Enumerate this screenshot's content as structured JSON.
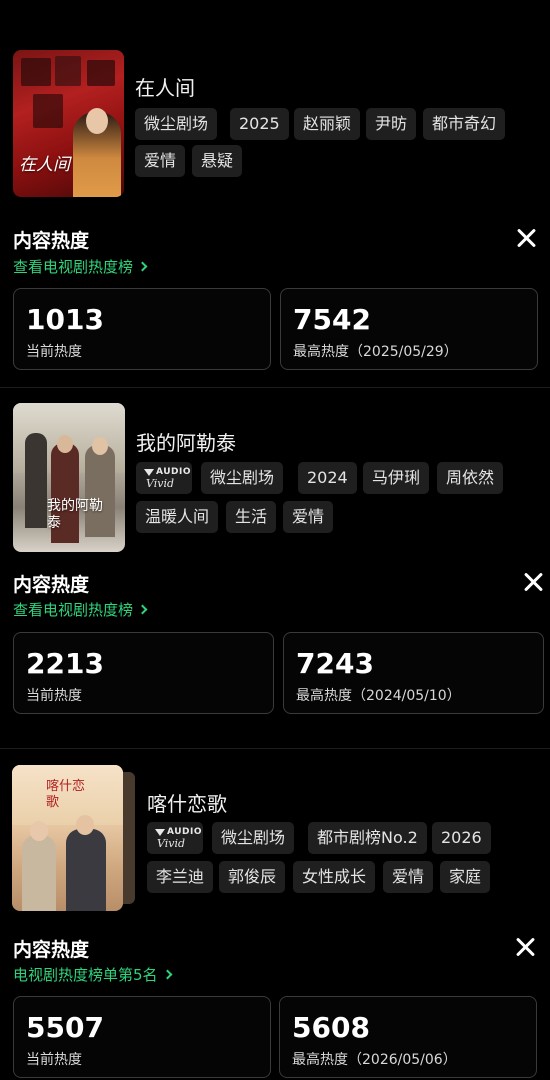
{
  "shows": [
    {
      "title": "在人间",
      "poster_caption": "在人间",
      "tags": [
        "微尘剧场",
        "2025",
        "赵丽颖",
        "尹昉",
        "都市奇幻",
        "爱情",
        "悬疑"
      ],
      "heat_title": "内容热度",
      "link_label": "查看电视剧热度榜",
      "current_value": "1013",
      "current_label": "当前热度",
      "peak_value": "7542",
      "peak_label": "最高热度（2025/05/29）"
    },
    {
      "title": "我的阿勒泰",
      "poster_caption": "我的阿勒泰",
      "audio_badge": {
        "top": "AUDIO",
        "bottom": "Vivid"
      },
      "tags": [
        "微尘剧场",
        "2024",
        "马伊琍",
        "周依然",
        "温暖人间",
        "生活",
        "爱情"
      ],
      "heat_title": "内容热度",
      "link_label": "查看电视剧热度榜",
      "current_value": "2213",
      "current_label": "当前热度",
      "peak_value": "7243",
      "peak_label": "最高热度（2024/05/10）"
    },
    {
      "title": "喀什恋歌",
      "poster_caption": "喀什恋歌",
      "audio_badge": {
        "top": "AUDIO",
        "bottom": "Vivid"
      },
      "tags": [
        "微尘剧场",
        "都市剧榜No.2",
        "2026",
        "李兰迪",
        "郭俊辰",
        "女性成长",
        "爱情",
        "家庭"
      ],
      "heat_title": "内容热度",
      "link_label": "电视剧热度榜单第5名",
      "current_value": "5507",
      "current_label": "当前热度",
      "peak_value": "5608",
      "peak_label": "最高热度（2026/05/06）"
    }
  ],
  "colors": {
    "accent_green": "#2fd37a",
    "background": "#000000",
    "card_border": "#3a3a3a",
    "tag_bg": "#1f1f1f"
  },
  "icons": {
    "close": "close-icon",
    "chevron": "chevron-right-icon",
    "audio": "audio-vivid-icon"
  }
}
